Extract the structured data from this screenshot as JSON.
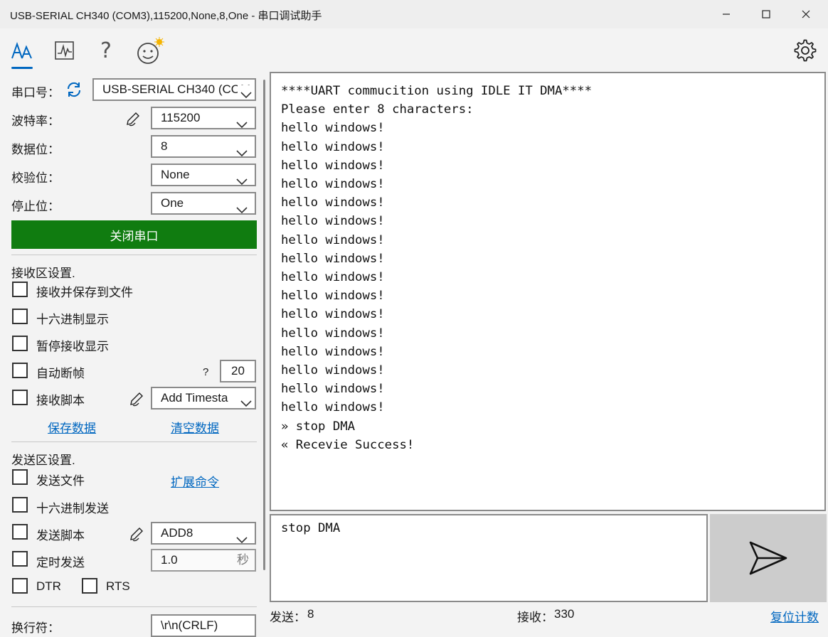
{
  "window": {
    "title": "USB-SERIAL CH340 (COM3),115200,None,8,One - 串口调试助手"
  },
  "toolbar": {
    "tools": [
      "font-size-icon",
      "chart-icon",
      "help-icon",
      "emoji-icon"
    ],
    "active": "font-size-icon",
    "settings": "gear-icon",
    "accent": "#0067c0"
  },
  "serial": {
    "port_label": "串口号：",
    "port_value": "USB-SERIAL CH340 (COM",
    "baud_label": "波特率：",
    "baud_value": "115200",
    "databits_label": "数据位：",
    "databits_value": "8",
    "parity_label": "校验位：",
    "parity_value": "None",
    "stopbits_label": "停止位：",
    "stopbits_value": "One",
    "close_port_button": "关闭串口",
    "close_port_color": "#107c10"
  },
  "receive": {
    "section_title": "接收区设置.",
    "save_to_file": "接收并保存到文件",
    "hex_display": "十六进制显示",
    "pause_display": "暂停接收显示",
    "auto_frame": "自动断帧",
    "auto_frame_help": "?",
    "auto_frame_value": "20",
    "script_label": "接收脚本",
    "script_value": "Add Timesta",
    "save_data_link": "保存数据",
    "clear_data_link": "清空数据"
  },
  "send": {
    "section_title": "发送区设置.",
    "send_file": "发送文件",
    "ext_cmd_link": "扩展命令",
    "hex_send": "十六进制发送",
    "script_label": "发送脚本",
    "script_value": "ADD8",
    "timer_label": "定时发送",
    "timer_value": "1.0",
    "timer_unit": "秒",
    "dtr": "DTR",
    "rts": "RTS",
    "newline_label": "换行符：",
    "newline_value": "\\r\\n(CRLF)"
  },
  "rx_lines": [
    "****UART commucition using IDLE IT DMA****",
    "Please enter 8 characters:",
    "hello windows!",
    "hello windows!",
    "hello windows!",
    "hello windows!",
    "hello windows!",
    "hello windows!",
    "hello windows!",
    "hello windows!",
    "hello windows!",
    "hello windows!",
    "hello windows!",
    "hello windows!",
    "hello windows!",
    "hello windows!",
    "hello windows!",
    "hello windows!",
    "» stop DMA",
    "« Recevie Success!"
  ],
  "tx_text": "stop DMA",
  "status": {
    "sent_label": "发送：",
    "sent_count": "8",
    "recv_label": "接收：",
    "recv_count": "330",
    "reset_link": "复位计数"
  }
}
